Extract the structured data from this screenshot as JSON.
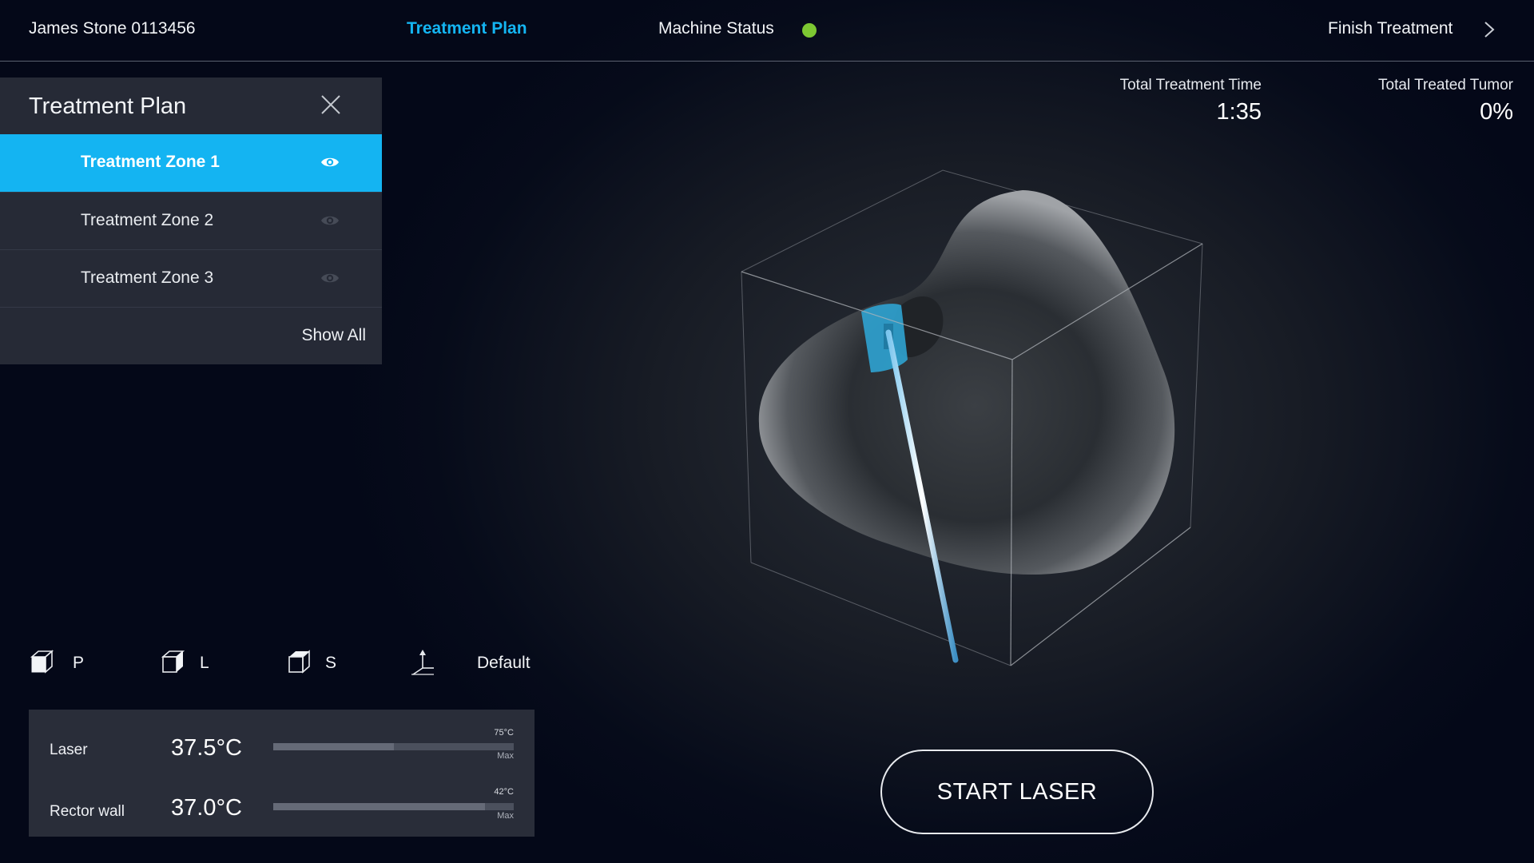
{
  "header": {
    "patient": "James Stone 0113456",
    "tab_plan": "Treatment Plan",
    "machine_status_label": "Machine Status",
    "machine_status_color": "#7dc832",
    "finish_label": "Finish Treatment"
  },
  "plan_panel": {
    "title": "Treatment Plan",
    "zones": [
      {
        "label": "Treatment Zone 1",
        "active": true
      },
      {
        "label": "Treatment Zone 2",
        "active": false
      },
      {
        "label": "Treatment Zone 3",
        "active": false
      }
    ],
    "show_all": "Show All"
  },
  "stats": {
    "time_label": "Total Treatment Time",
    "time_value": "1:35",
    "tumor_label": "Total Treated Tumor",
    "tumor_value": "0%"
  },
  "views": [
    {
      "label": "P",
      "icon": "cube-front-icon"
    },
    {
      "label": "L",
      "icon": "cube-side-icon"
    },
    {
      "label": "S",
      "icon": "cube-top-icon"
    },
    {
      "label": "Default",
      "icon": "axes-icon"
    }
  ],
  "temps": [
    {
      "label": "Laser",
      "value": "37.5°C",
      "max": "75°C",
      "max_label": "Max",
      "fraction": 0.5
    },
    {
      "label": "Rector wall",
      "value": "37.0°C",
      "max": "42°C",
      "max_label": "Max",
      "fraction": 0.88
    }
  ],
  "start_button": "START LASER",
  "colors": {
    "accent": "#14b4f2",
    "panel": "#262a36"
  }
}
